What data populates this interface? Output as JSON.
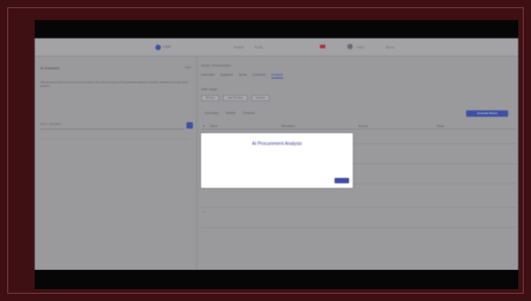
{
  "app": {
    "logo_text": "Logo",
    "nav_links": [
      "Home",
      "Tools"
    ],
    "user_label": "User",
    "menu_label": "Menu"
  },
  "left_panel": {
    "title": "AI Assistant",
    "hide_label": "Hide",
    "description": "Ask questions about the procurement data in this view and get an AI-generated analysis of trends, suppliers and spending patterns.",
    "input_placeholder": "Ask a question..."
  },
  "main": {
    "breadcrumb": "Home / Procurement",
    "tabs": [
      {
        "label": "Overview",
        "active": false
      },
      {
        "label": "Suppliers",
        "active": false
      },
      {
        "label": "Items",
        "active": false
      },
      {
        "label": "Contracts",
        "active": false
      },
      {
        "label": "Analysis",
        "active": true
      }
    ],
    "filter_label": "Date range",
    "filters": [
      "All time",
      "Last 30 days",
      "Custom"
    ],
    "subtabs": [
      "Summary",
      "Details",
      "Timeline"
    ],
    "action_button": "Generate Report",
    "table": {
      "columns": [
        "#",
        "Name",
        "Description",
        "Amount",
        "Notes"
      ],
      "rows": [
        [
          "1",
          "",
          "",
          "",
          ""
        ],
        [
          "2",
          "",
          "",
          "",
          ""
        ],
        [
          "3",
          "",
          "",
          "",
          ""
        ],
        [
          "4",
          "",
          "",
          "",
          ""
        ],
        [
          "5",
          "",
          "",
          "",
          ""
        ]
      ]
    }
  },
  "modal": {
    "title": "AI Procurement Analysis",
    "button_label": "OK"
  },
  "colors": {
    "accent": "#3f4fa3",
    "backdrop": "#3e1014",
    "overlay": "#9a9a9d"
  }
}
